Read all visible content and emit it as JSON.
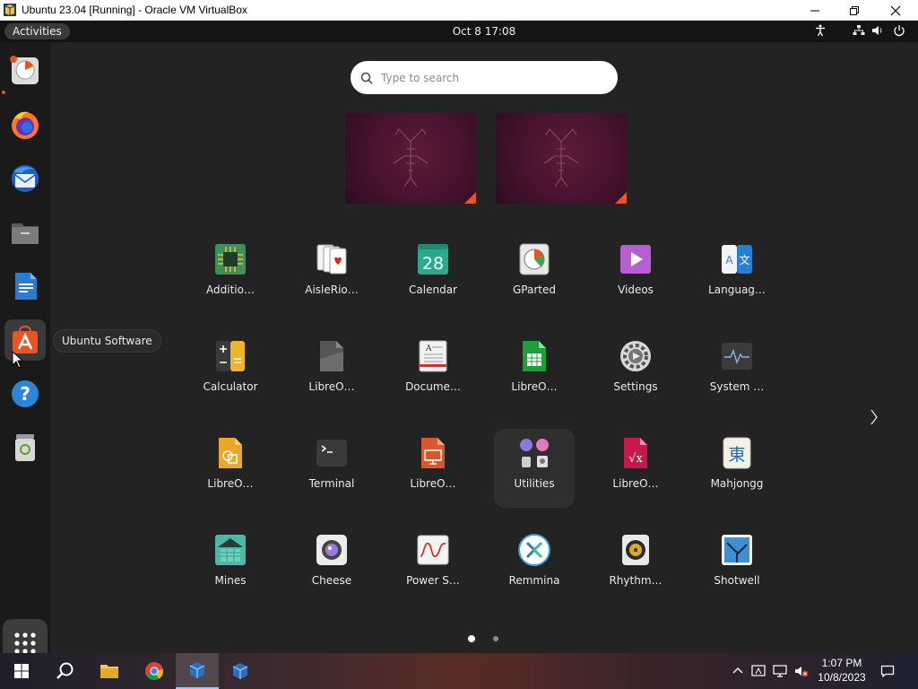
{
  "window": {
    "title": "Ubuntu 23.04 [Running] - Oracle VM VirtualBox"
  },
  "topbar": {
    "activities_label": "Activities",
    "clock": "Oct 8  17:08"
  },
  "dock": {
    "items": [
      "Disk Usage",
      "Firefox",
      "Thunderbird",
      "Files",
      "LibreOffice Writer",
      "Ubuntu Software",
      "Help",
      "Trash"
    ],
    "tooltip": "Ubuntu Software"
  },
  "search": {
    "placeholder": "Type to search"
  },
  "apps": [
    {
      "label": "Additio…",
      "icon": "additional-drivers-icon"
    },
    {
      "label": "AisleRio…",
      "icon": "aisleriot-icon"
    },
    {
      "label": "Calendar",
      "icon": "calendar-icon",
      "day": "28"
    },
    {
      "label": "GParted",
      "icon": "gparted-icon"
    },
    {
      "label": "Videos",
      "icon": "videos-icon"
    },
    {
      "label": "Languag…",
      "icon": "language-support-icon",
      "glyph": "文"
    },
    {
      "label": "Calculator",
      "icon": "calculator-icon"
    },
    {
      "label": "LibreO…",
      "icon": "libreoffice-icon"
    },
    {
      "label": "Docume…",
      "icon": "document-viewer-icon"
    },
    {
      "label": "LibreO…",
      "icon": "libreoffice-calc-icon"
    },
    {
      "label": "Settings",
      "icon": "settings-icon"
    },
    {
      "label": "System …",
      "icon": "system-monitor-icon"
    },
    {
      "label": "LibreO…",
      "icon": "libreoffice-draw-icon"
    },
    {
      "label": "Terminal",
      "icon": "terminal-icon"
    },
    {
      "label": "LibreO…",
      "icon": "libreoffice-impress-icon"
    },
    {
      "label": "Utilities",
      "icon": "utilities-folder-icon"
    },
    {
      "label": "LibreO…",
      "icon": "libreoffice-math-icon"
    },
    {
      "label": "Mahjongg",
      "icon": "mahjongg-icon",
      "glyph": "東"
    },
    {
      "label": "Mines",
      "icon": "mines-icon"
    },
    {
      "label": "Cheese",
      "icon": "cheese-icon"
    },
    {
      "label": "Power S…",
      "icon": "power-statistics-icon"
    },
    {
      "label": "Remmina",
      "icon": "remmina-icon"
    },
    {
      "label": "Rhythm…",
      "icon": "rhythmbox-icon"
    },
    {
      "label": "Shotwell",
      "icon": "shotwell-icon"
    }
  ],
  "pages": {
    "count": 2,
    "current": 1
  },
  "taskbar": {
    "time": "1:07 PM",
    "date": "10/8/2023"
  },
  "colors": {
    "accent": "#e95420",
    "panel": "#141414",
    "background": "#232323"
  }
}
